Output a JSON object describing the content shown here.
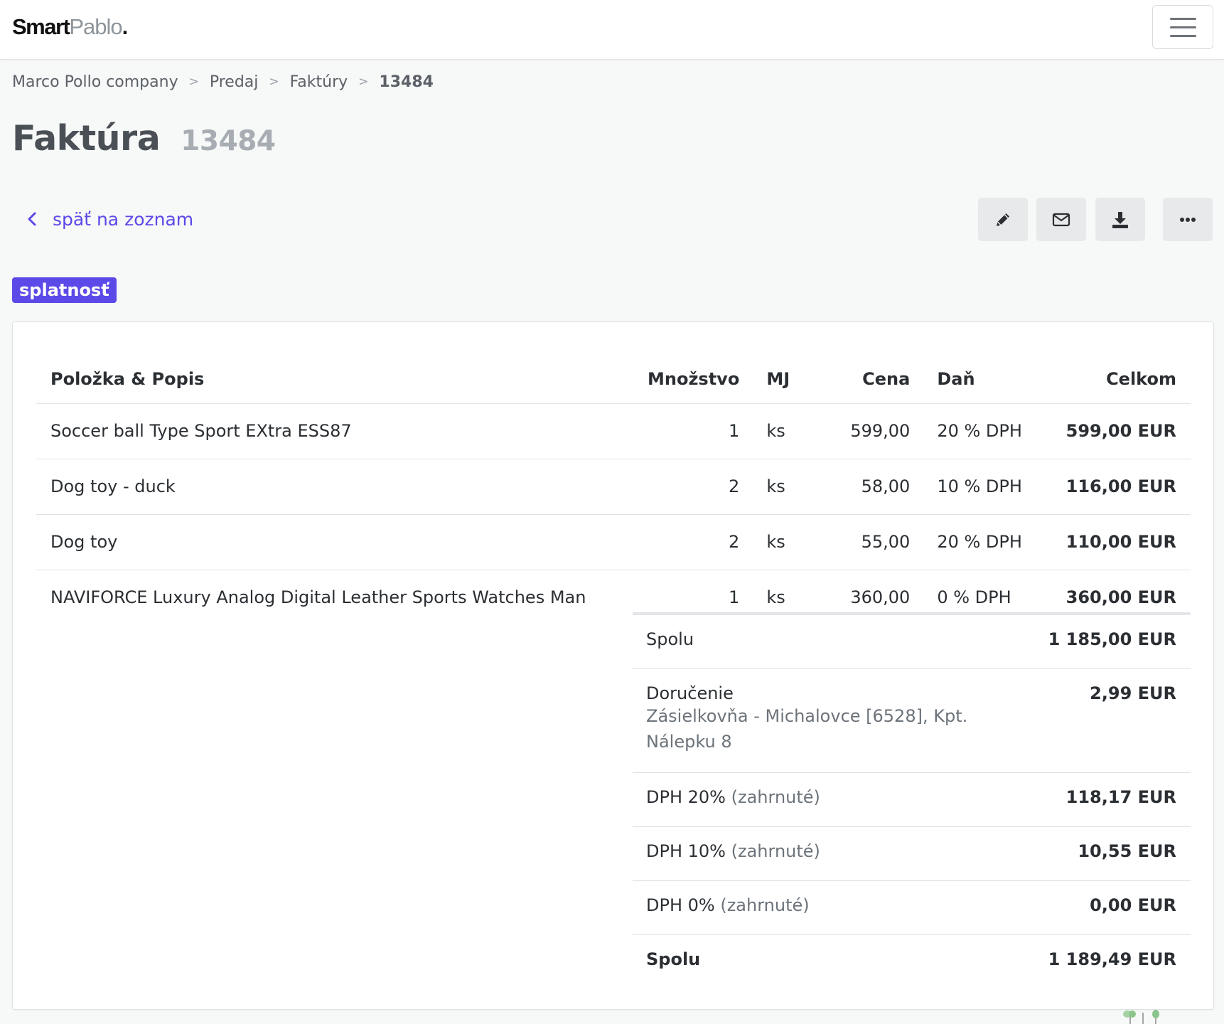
{
  "navbar": {
    "logo_part1": "Smart",
    "logo_part2": "Pablo",
    "logo_dot": "."
  },
  "breadcrumb": [
    {
      "label": "Marco Pollo company"
    },
    {
      "label": "Predaj"
    },
    {
      "label": "Faktúry"
    },
    {
      "label": "13484"
    }
  ],
  "breadcrumb_separator": ">",
  "page": {
    "title": "Faktúra",
    "number": "13484",
    "back_label": "späť na zoznam",
    "status_badge": "splatnosť"
  },
  "toolbar": {
    "icons": [
      "pencil-icon",
      "envelope-icon",
      "download-icon",
      "more-icon"
    ]
  },
  "colors": {
    "accent": "#5b49e8",
    "button_bg": "#e8e9eb",
    "page_bg": "#f7f8f8"
  },
  "table": {
    "headers": {
      "desc": "Položka & Popis",
      "qty": "Množstvo",
      "unit": "MJ",
      "price": "Cena",
      "tax": "Daň",
      "total": "Celkom"
    },
    "rows": [
      {
        "desc": "Soccer ball Type Sport EXtra ESS87",
        "qty": "1",
        "unit": "ks",
        "price": "599,00",
        "tax": "20 % DPH",
        "total": "599,00 EUR"
      },
      {
        "desc": "Dog toy - duck",
        "qty": "2",
        "unit": "ks",
        "price": "58,00",
        "tax": "10 % DPH",
        "total": "116,00 EUR"
      },
      {
        "desc": "Dog toy",
        "qty": "2",
        "unit": "ks",
        "price": "55,00",
        "tax": "20 % DPH",
        "total": "110,00 EUR"
      },
      {
        "desc": "NAVIFORCE Luxury Analog Digital Leather Sports Watches Man",
        "qty": "1",
        "unit": "ks",
        "price": "360,00",
        "tax": "0 % DPH",
        "total": "360,00 EUR"
      }
    ]
  },
  "summary": {
    "subtotal_label": "Spolu",
    "subtotal_value": "1 185,00 EUR",
    "delivery_label": "Doručenie",
    "delivery_detail_1": "Zásielkovňa - Michalovce [6528], Kpt.",
    "delivery_detail_2": "Nálepku 8",
    "delivery_value": "2,99 EUR",
    "vat": [
      {
        "label": "DPH 20%",
        "note": "(zahrnuté)",
        "value": "118,17 EUR"
      },
      {
        "label": "DPH 10%",
        "note": "(zahrnuté)",
        "value": "10,55 EUR"
      },
      {
        "label": "DPH 0%",
        "note": "(zahrnuté)",
        "value": "0,00 EUR"
      }
    ],
    "total_label": "Spolu",
    "total_value": "1 189,49 EUR"
  }
}
